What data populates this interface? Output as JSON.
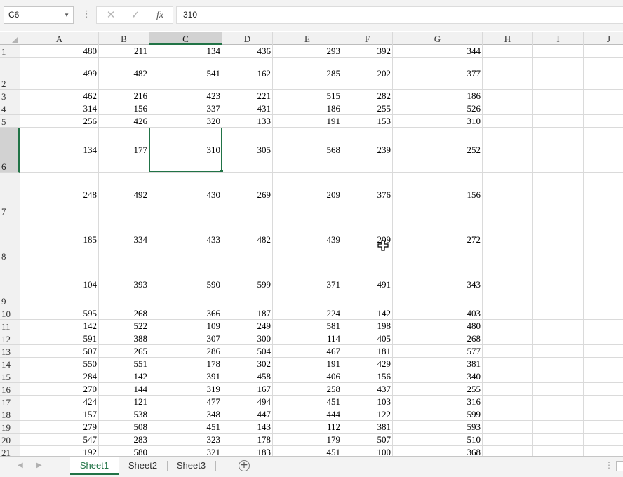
{
  "formula_bar": {
    "name_box": "C6",
    "formula": "310",
    "cancel_icon": "close-icon",
    "enter_icon": "check-icon",
    "function_label": "fx"
  },
  "grid": {
    "columns": [
      "A",
      "B",
      "C",
      "D",
      "E",
      "F",
      "G",
      "H",
      "I",
      "J"
    ],
    "active_column": "C",
    "active_row": "6",
    "active_cell": "C6",
    "rows": [
      {
        "label": "1",
        "values": [
          "480",
          "211",
          "134",
          "436",
          "293",
          "392",
          "344"
        ]
      },
      {
        "label": "2",
        "values": [
          "499",
          "482",
          "541",
          "162",
          "285",
          "202",
          "377"
        ]
      },
      {
        "label": "3",
        "values": [
          "462",
          "216",
          "423",
          "221",
          "515",
          "282",
          "186"
        ]
      },
      {
        "label": "4",
        "values": [
          "314",
          "156",
          "337",
          "431",
          "186",
          "255",
          "526"
        ]
      },
      {
        "label": "5",
        "values": [
          "256",
          "426",
          "320",
          "133",
          "191",
          "153",
          "310"
        ]
      },
      {
        "label": "6",
        "values": [
          "134",
          "177",
          "310",
          "305",
          "568",
          "239",
          "252"
        ]
      },
      {
        "label": "7",
        "values": [
          "248",
          "492",
          "430",
          "269",
          "209",
          "376",
          "156"
        ]
      },
      {
        "label": "8",
        "values": [
          "185",
          "334",
          "433",
          "482",
          "439",
          "209",
          "272"
        ]
      },
      {
        "label": "9",
        "values": [
          "104",
          "393",
          "590",
          "599",
          "371",
          "491",
          "343"
        ]
      },
      {
        "label": "10",
        "values": [
          "595",
          "268",
          "366",
          "187",
          "224",
          "142",
          "403"
        ]
      },
      {
        "label": "11",
        "values": [
          "142",
          "522",
          "109",
          "249",
          "581",
          "198",
          "480"
        ]
      },
      {
        "label": "12",
        "values": [
          "591",
          "388",
          "307",
          "300",
          "114",
          "405",
          "268"
        ]
      },
      {
        "label": "13",
        "values": [
          "507",
          "265",
          "286",
          "504",
          "467",
          "181",
          "577"
        ]
      },
      {
        "label": "14",
        "values": [
          "550",
          "551",
          "178",
          "302",
          "191",
          "429",
          "381"
        ]
      },
      {
        "label": "15",
        "values": [
          "284",
          "142",
          "391",
          "458",
          "406",
          "156",
          "340"
        ]
      },
      {
        "label": "16",
        "values": [
          "270",
          "144",
          "319",
          "167",
          "258",
          "437",
          "255"
        ]
      },
      {
        "label": "17",
        "values": [
          "424",
          "121",
          "477",
          "494",
          "451",
          "103",
          "316"
        ]
      },
      {
        "label": "18",
        "values": [
          "157",
          "538",
          "348",
          "447",
          "444",
          "122",
          "599"
        ]
      },
      {
        "label": "19",
        "values": [
          "279",
          "508",
          "451",
          "143",
          "112",
          "381",
          "593"
        ]
      },
      {
        "label": "20",
        "values": [
          "547",
          "283",
          "323",
          "178",
          "179",
          "507",
          "510"
        ]
      },
      {
        "label": "21",
        "values": [
          "192",
          "580",
          "321",
          "183",
          "451",
          "100",
          "368"
        ]
      }
    ]
  },
  "cursor_icon": "move-cross-cursor-icon",
  "sheet_tabs": {
    "tabs": [
      "Sheet1",
      "Sheet2",
      "Sheet3"
    ],
    "active": "Sheet1",
    "add_icon": "plus-circle-icon"
  }
}
